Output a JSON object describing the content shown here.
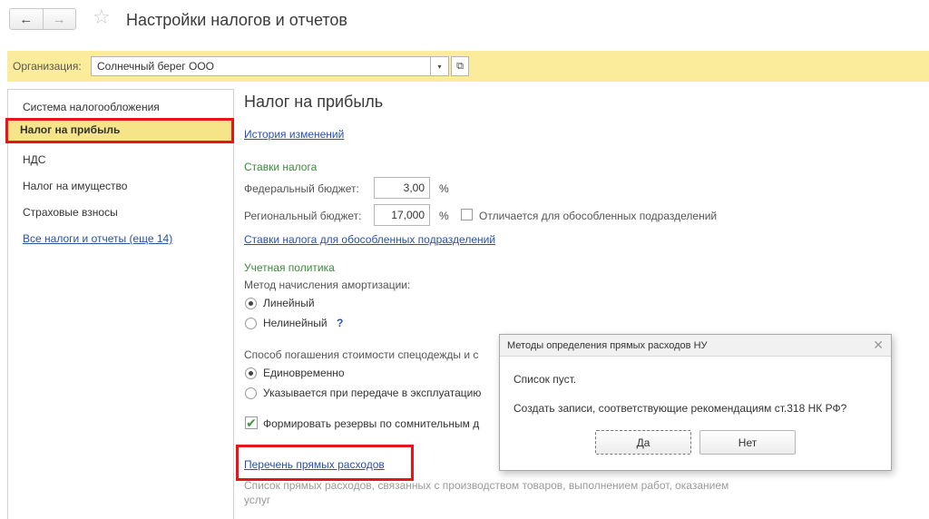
{
  "window": {
    "back_icon": "←",
    "forward_icon": "→",
    "star_icon": "☆",
    "title": "Настройки налогов и отчетов"
  },
  "org": {
    "label": "Организация:",
    "value": "Солнечный берег ООО",
    "dropdown_icon": "▾",
    "open_icon": "⧉"
  },
  "sidebar": {
    "items": [
      {
        "label": "Система налогообложения"
      },
      {
        "label": "Налог на прибыль"
      },
      {
        "label": "НДС"
      },
      {
        "label": "Налог на имущество"
      },
      {
        "label": "Страховые взносы"
      },
      {
        "label": "Все налоги и отчеты (еще 14)"
      }
    ]
  },
  "main": {
    "heading": "Налог на прибыль",
    "history_link": "История изменений",
    "rates_title": "Ставки налога",
    "federal_label": "Федеральный бюджет:",
    "federal_value": "3,00",
    "regional_label": "Региональный бюджет:",
    "regional_value": "17,000",
    "percent": "%",
    "differs_label": "Отличается для обособленных подразделений",
    "branch_rates_link": "Ставки налога для обособленных подразделений",
    "policy_title": "Учетная политика",
    "depreciation_label": "Метод начисления амортизации:",
    "linear_label": "Линейный",
    "nonlinear_label": "Нелинейный",
    "help_mark": "?",
    "workwear_label": "Способ погашения стоимости спецодежды и с",
    "onetime_label": "Единовременно",
    "onuse_label": "Указывается при передаче в эксплуатацию",
    "reserves_label": "Формировать резервы по сомнительным д",
    "reserves_check": "✔",
    "direct_costs_link": "Перечень прямых расходов",
    "direct_costs_desc_1": "Список прямых расходов, связанных с производством товаров, выполнением работ, оказанием",
    "direct_costs_desc_2": "услуг"
  },
  "dialog": {
    "title": "Методы определения прямых расходов НУ",
    "close_icon": "✕",
    "line1": "Список пуст.",
    "line2": "Создать записи, соответствующие рекомендациям ст.318 НК РФ?",
    "yes": "Да",
    "no": "Нет"
  },
  "colors": {
    "org_bar": "#fbec9b",
    "active_item": "#f6e489",
    "highlight": "#e8141c",
    "link": "#2852a6",
    "section": "#3c8a3c"
  }
}
